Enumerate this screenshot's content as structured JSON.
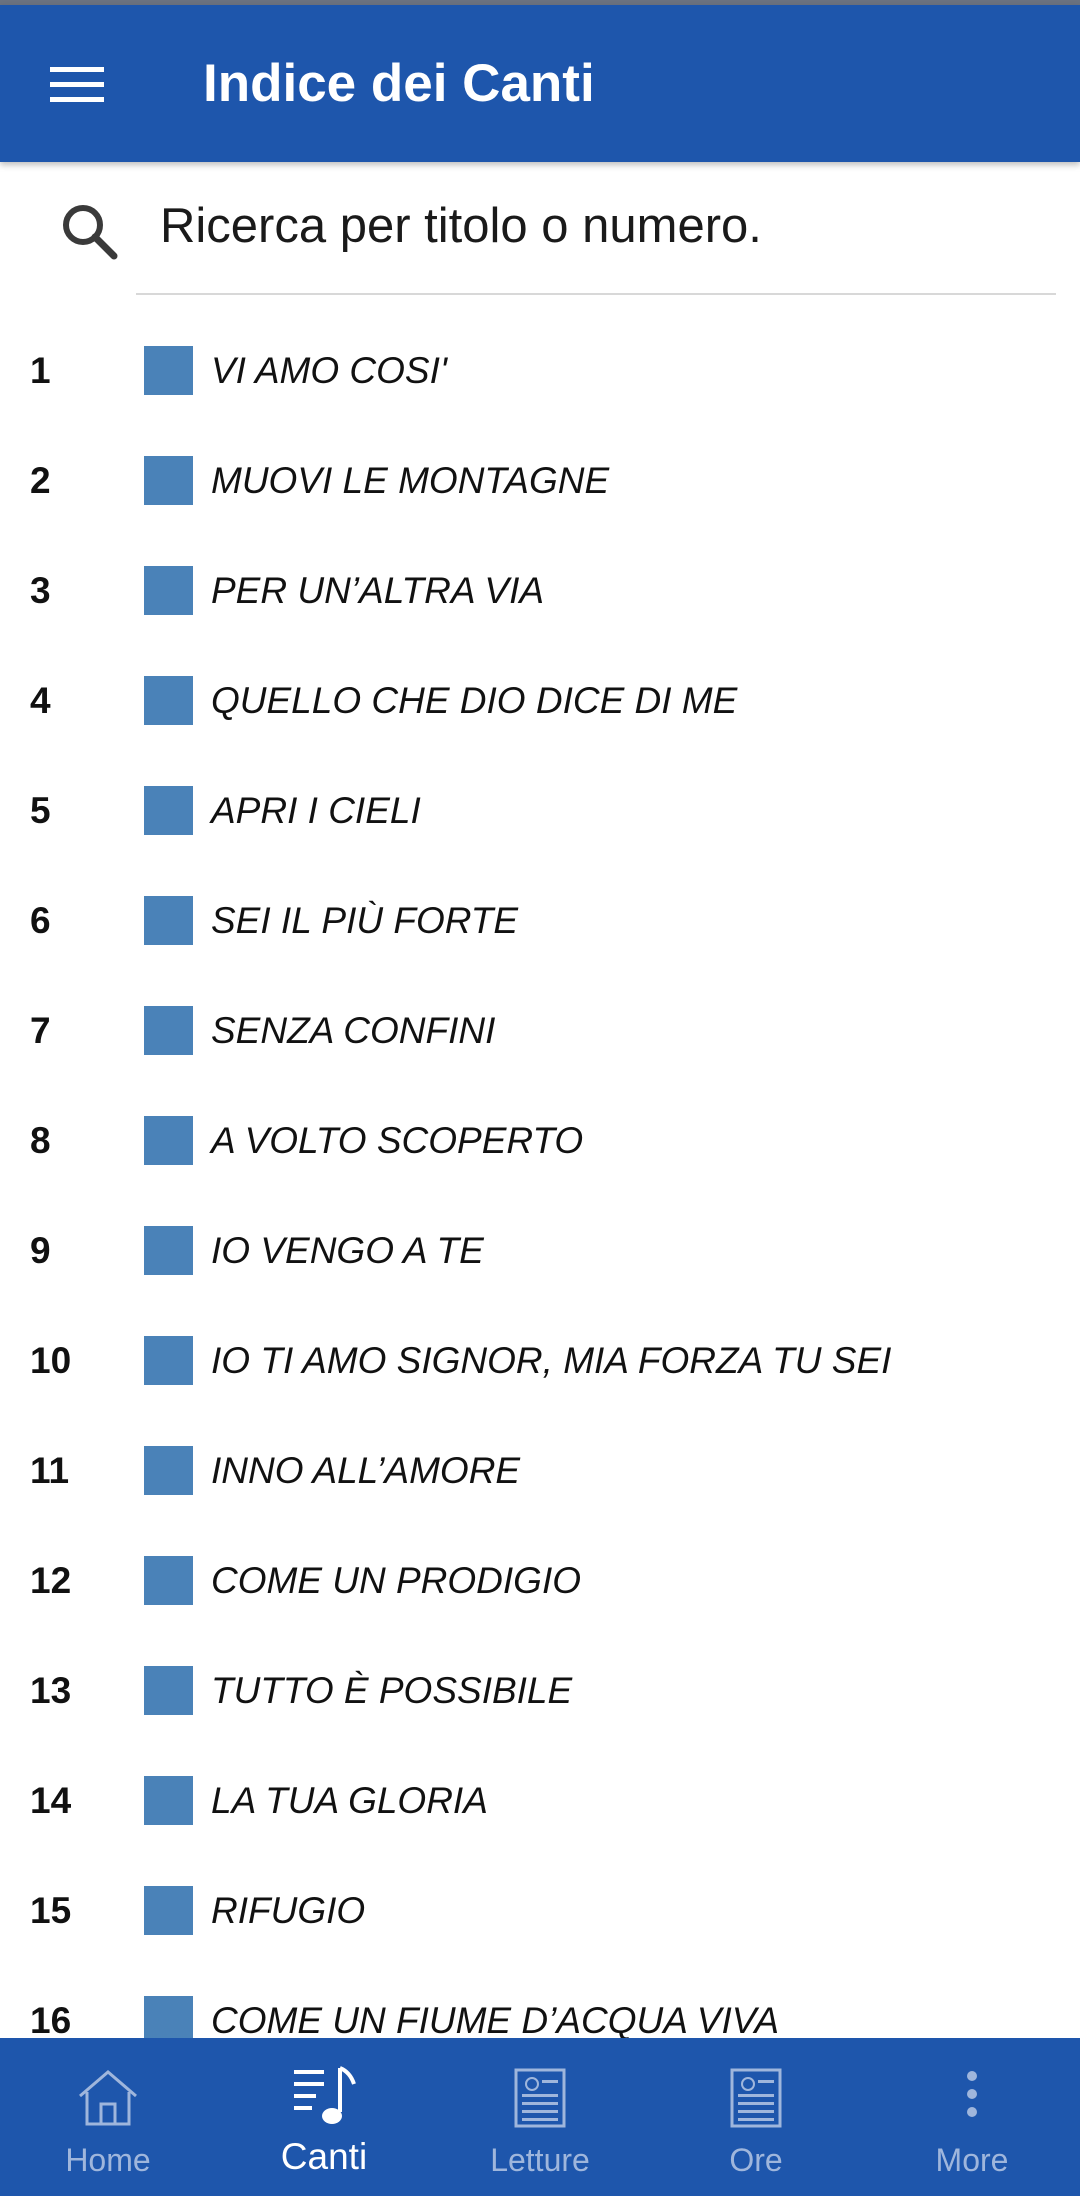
{
  "app_bar": {
    "title": "Indice dei Canti",
    "background": "#1e56ac",
    "menu_icon": "hamburger-menu-icon"
  },
  "search": {
    "placeholder": "Ricerca per titolo o numero.",
    "icon": "search-icon"
  },
  "songs": [
    {
      "number": "1",
      "title": "VI AMO COSI'"
    },
    {
      "number": "2",
      "title": "MUOVI LE MONTAGNE"
    },
    {
      "number": "3",
      "title": "PER UN’ALTRA VIA"
    },
    {
      "number": "4",
      "title": "QUELLO CHE DIO DICE DI ME"
    },
    {
      "number": "5",
      "title": "APRI I CIELI"
    },
    {
      "number": "6",
      "title": "SEI IL PIÙ FORTE"
    },
    {
      "number": "7",
      "title": "SENZA CONFINI"
    },
    {
      "number": "8",
      "title": "A VOLTO SCOPERTO"
    },
    {
      "number": "9",
      "title": "IO VENGO A TE"
    },
    {
      "number": "10",
      "title": "IO TI AMO SIGNOR, MIA FORZA TU SEI"
    },
    {
      "number": "11",
      "title": "INNO ALL’AMORE"
    },
    {
      "number": "12",
      "title": "COME UN PRODIGIO"
    },
    {
      "number": "13",
      "title": "TUTTO È POSSIBILE"
    },
    {
      "number": "14",
      "title": "LA TUA GLORIA"
    },
    {
      "number": "15",
      "title": "RIFUGIO"
    },
    {
      "number": "16",
      "title": "COME UN FIUME D’ACQUA VIVA"
    }
  ],
  "song_marker_color": "#4a82b8",
  "bottom_nav": {
    "items": [
      {
        "label": "Home",
        "icon": "home-icon",
        "active": false
      },
      {
        "label": "Canti",
        "icon": "music-list-icon",
        "active": true
      },
      {
        "label": "Letture",
        "icon": "reading-icon",
        "active": false
      },
      {
        "label": "Ore",
        "icon": "hours-icon",
        "active": false
      },
      {
        "label": "More",
        "icon": "more-vertical-icon",
        "active": false
      }
    ],
    "active_color": "#ffffff",
    "inactive_color": "#9fb6dc"
  }
}
